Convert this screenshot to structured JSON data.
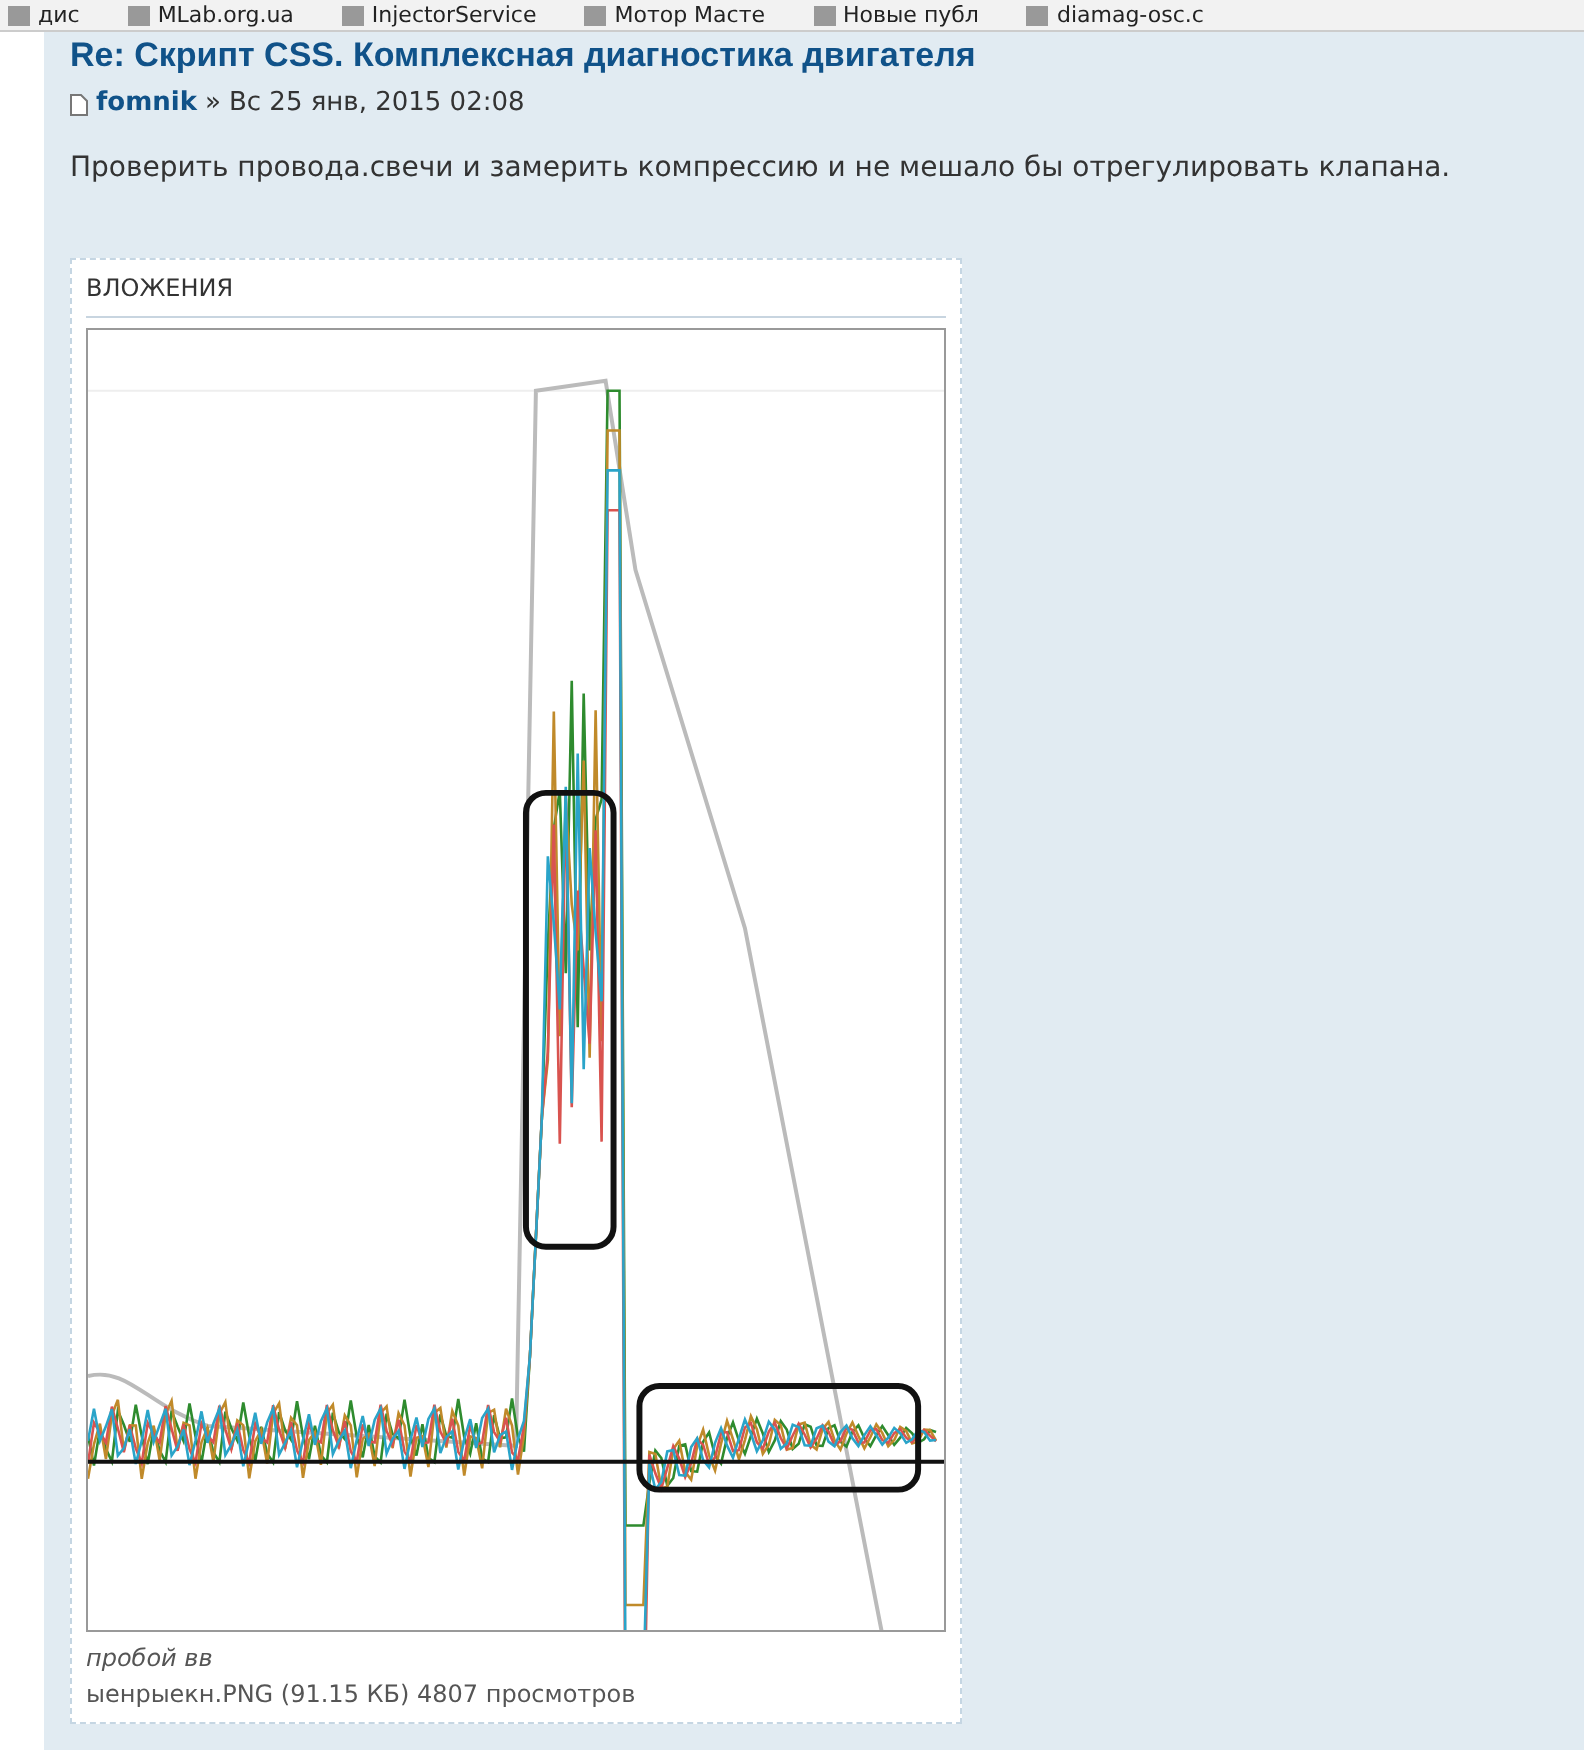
{
  "bookmarks": [
    {
      "label": "диc"
    },
    {
      "label": "MLab.org.ua"
    },
    {
      "label": "InjectorService"
    },
    {
      "label": "Мотор Масте"
    },
    {
      "label": "Новые публ"
    },
    {
      "label": "diamag-osc.c"
    }
  ],
  "post": {
    "title": "Re: Скрипт CSS. Комплексная диагностика двигателя",
    "author": "fomnik",
    "separator": "»",
    "date": "Вс 25 янв, 2015 02:08",
    "body": "Проверить провода.свечи и замерить компрессию и не мешало бы отрегулировать клапана."
  },
  "attachments": {
    "heading": "ВЛОЖЕНИЯ",
    "items": [
      {
        "comment": "пробой вв",
        "file": "ыенрыекн.PNG (91.15 КБ) 4807 просмотров"
      }
    ]
  }
}
